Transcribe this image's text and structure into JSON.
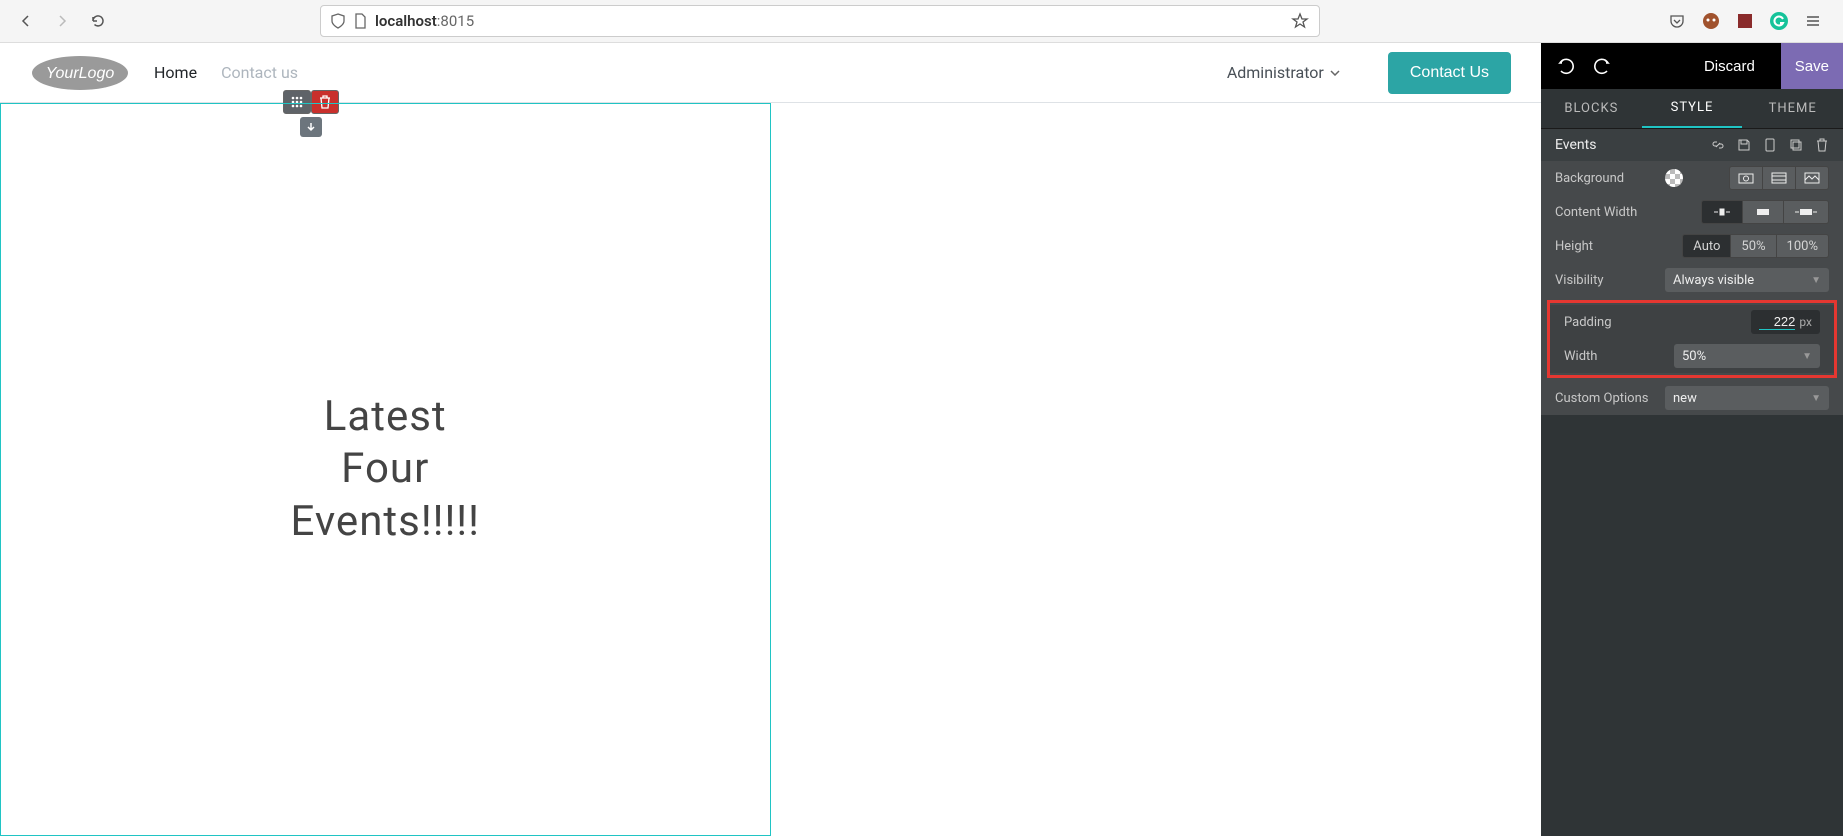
{
  "browser": {
    "url_host": "localhost",
    "url_port": ":8015"
  },
  "site": {
    "nav": {
      "home": "Home",
      "contact": "Contact us"
    },
    "admin_label": "Administrator",
    "contact_button": "Contact Us"
  },
  "canvas": {
    "block_text": "Latest\nFour\nEvents!!!!!"
  },
  "editor": {
    "top": {
      "discard": "Discard",
      "save": "Save"
    },
    "tabs": {
      "blocks": "BLOCKS",
      "style": "STYLE",
      "theme": "THEME"
    },
    "section_title": "Events",
    "props": {
      "background": "Background",
      "content_width": "Content Width",
      "height": "Height",
      "height_opts": {
        "auto": "Auto",
        "half": "50%",
        "full": "100%"
      },
      "visibility": "Visibility",
      "visibility_value": "Always visible",
      "padding": "Padding",
      "padding_value": "222",
      "padding_unit": "px",
      "width": "Width",
      "width_value": "50%",
      "custom": "Custom Options",
      "custom_value": "new"
    }
  }
}
